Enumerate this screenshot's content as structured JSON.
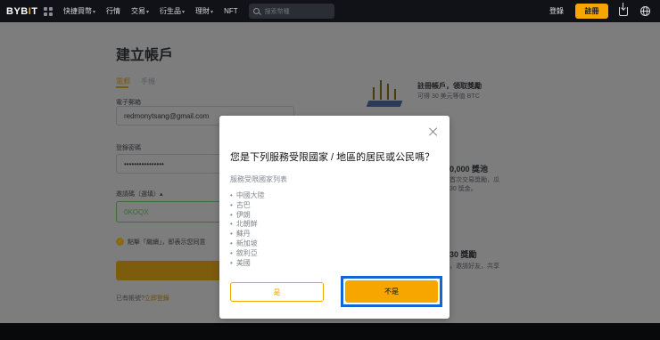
{
  "nav": {
    "logo_a": "BYB",
    "logo_b": "I",
    "logo_c": "T",
    "items": [
      "快捷買幣",
      "行情",
      "交易",
      "衍生品",
      "理財",
      "NFT"
    ],
    "search_placeholder": "搜索幣種",
    "login": "登錄",
    "register": "註冊"
  },
  "page": {
    "title": "建立帳戶",
    "tab_email": "電郵",
    "tab_phone": "手機",
    "email_label": "電子郵箱",
    "email_value": "redmonytsang@gmail.com",
    "password_label": "登錄密碼",
    "password_value": "••••••••••••••••",
    "code_label": "邀請碼（選填）▴",
    "code_value": "0KOQX",
    "agree_text": "點擊「繼續」，即表示您同意",
    "have_account": "已有帳號?",
    "login_link": "立即登錄"
  },
  "promos": {
    "p1_title": "註冊帳戶，領取獎勵",
    "p1_sub": "可得 30 美元等值 BTC",
    "p2_title": "0,000 獎池",
    "p2_line1": "首次交易獎勵，瓜",
    "p2_line2": "30 獎金。",
    "p3_title": "30 獎勵",
    "p3_line1": "，邀請好友，共享"
  },
  "modal": {
    "title": "您是下列服務受限國家 / 地區的居民或公民嗎？",
    "subtitle": "服務受限國家列表",
    "regions": [
      "中國大陸",
      "古巴",
      "伊朗",
      "北朝鮮",
      "蘇丹",
      "新加坡",
      "敘利亞",
      "美國"
    ],
    "yes": "是",
    "no": "不是"
  },
  "colors": {
    "brand": "#f7a600",
    "highlight": "#1466d8"
  }
}
